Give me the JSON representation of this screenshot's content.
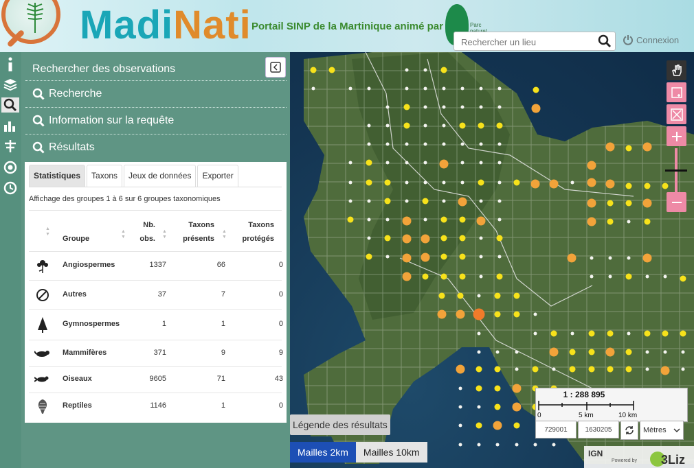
{
  "header": {
    "title_part1": "Madi",
    "title_part2": "Nati",
    "subtitle": "Portail SINP de la Martinique animé par",
    "search_placeholder": "Rechercher un lieu",
    "login_label": "Connexion"
  },
  "left_bar": {
    "icons": [
      "info-icon",
      "layers-icon",
      "search-icon",
      "bar-chart-icon",
      "filter-icon",
      "target-icon",
      "clock-icon"
    ]
  },
  "panel": {
    "title": "Rechercher des observations",
    "accordion": [
      "Recherche",
      "Information sur la requête",
      "Résultats"
    ],
    "tabs": [
      "Statistiques",
      "Taxons",
      "Jeux de données",
      "Exporter"
    ],
    "info": "Affichage des groupes 1 à 6 sur 6 groupes taxonomiques",
    "columns": {
      "groupe": "Groupe",
      "nb_obs_1": "Nb.",
      "nb_obs_2": "obs.",
      "taxons_1": "Taxons",
      "taxons_2": "présents",
      "proteges_1": "Taxons",
      "proteges_2": "protégés"
    },
    "rows": [
      {
        "groupe": "Angiospermes",
        "nb_obs": "1337",
        "taxons": "66",
        "proteges": "0",
        "icon": "flower-icon"
      },
      {
        "groupe": "Autres",
        "nb_obs": "37",
        "taxons": "7",
        "proteges": "0",
        "icon": "other-icon"
      },
      {
        "groupe": "Gymnospermes",
        "nb_obs": "1",
        "taxons": "1",
        "proteges": "0",
        "icon": "tree-icon"
      },
      {
        "groupe": "Mammifères",
        "nb_obs": "371",
        "taxons": "9",
        "proteges": "9",
        "icon": "mammal-icon"
      },
      {
        "groupe": "Oiseaux",
        "nb_obs": "9605",
        "taxons": "71",
        "proteges": "43",
        "icon": "bird-icon"
      },
      {
        "groupe": "Reptiles",
        "nb_obs": "1146",
        "taxons": "1",
        "proteges": "0",
        "icon": "reptile-icon"
      }
    ]
  },
  "map": {
    "legend_button": "Légende des résultats",
    "mesh_2km": "Mailles 2km",
    "mesh_10km": "Mailles 10km",
    "scale_ratio": "1 : 288 895",
    "scale_0": "0",
    "scale_5": "5 km",
    "scale_10": "10 km",
    "coord_x": "729001",
    "coord_y": "1630205",
    "units": "Mètres",
    "credit_ign": "IGN",
    "credit_powered": "Powered by",
    "credit_3liz": "3Liz"
  }
}
